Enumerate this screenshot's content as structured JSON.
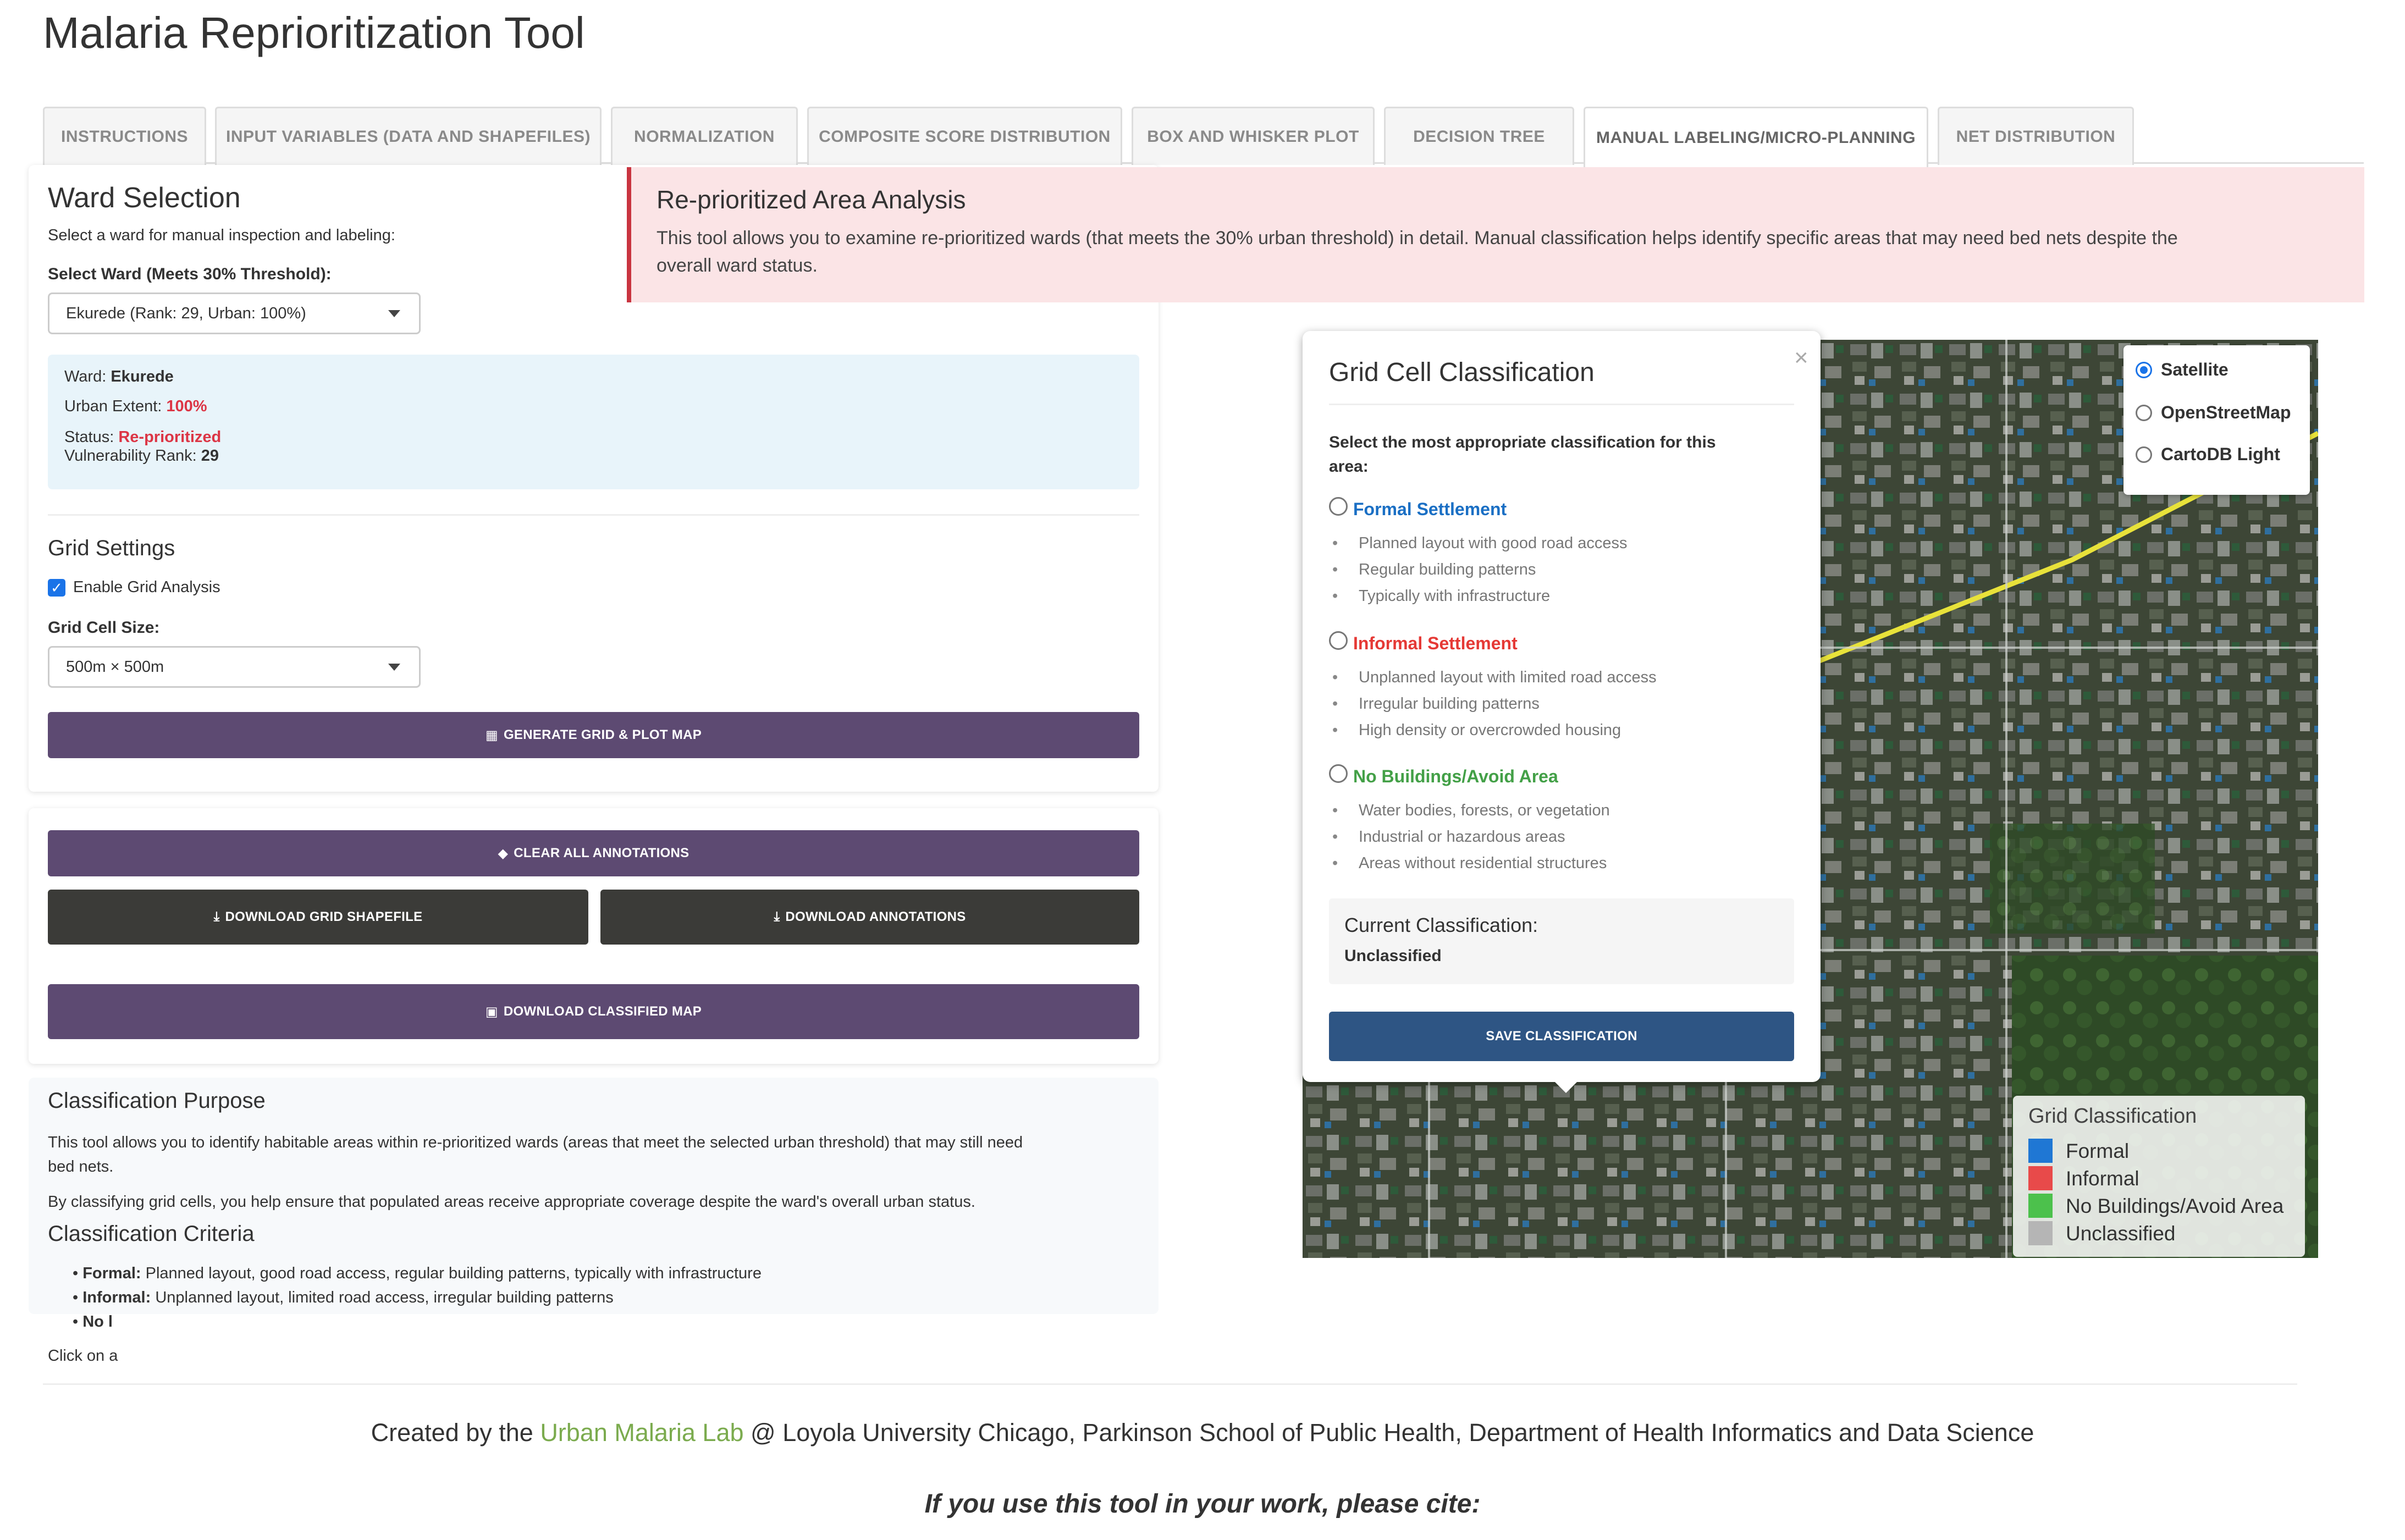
{
  "app": {
    "title": "Malaria Reprioritization Tool"
  },
  "tabs": [
    {
      "label": "INSTRUCTIONS"
    },
    {
      "label": "INPUT VARIABLES (DATA AND SHAPEFILES)"
    },
    {
      "label": "NORMALIZATION"
    },
    {
      "label": "COMPOSITE SCORE DISTRIBUTION"
    },
    {
      "label": "BOX AND WHISKER PLOT"
    },
    {
      "label": "DECISION TREE"
    },
    {
      "label": "MANUAL LABELING/MICRO-PLANNING"
    },
    {
      "label": "NET DISTRIBUTION"
    }
  ],
  "active_tab": "MANUAL LABELING/MICRO-PLANNING",
  "ward_selection": {
    "title": "Ward Selection",
    "description": "Select a ward for manual inspection and labeling:",
    "select_label": "Select Ward (Meets 30% Threshold):",
    "selected_value": "Ekurede (Rank: 29, Urban: 100%)",
    "info": {
      "ward_label": "Ward:",
      "ward_value": "Ekurede",
      "urban_label": "Urban Extent:",
      "urban_value": "100%",
      "status_label": "Status:",
      "status_value": "Re-prioritized",
      "rank_label": "Vulnerability Rank:",
      "rank_value": "29"
    }
  },
  "grid_settings": {
    "title": "Grid Settings",
    "checkbox_label": "Enable Grid Analysis",
    "checked": true,
    "cell_size_label": "Grid Cell Size:",
    "cell_size_value": "500m × 500m",
    "generate_button": "GENERATE GRID & PLOT MAP"
  },
  "actions": {
    "clear_button": "CLEAR ALL ANNOTATIONS",
    "download_grid_button": "DOWNLOAD GRID SHAPEFILE",
    "download_annotations_button": "DOWNLOAD ANNOTATIONS",
    "download_map_button": "DOWNLOAD CLASSIFIED MAP"
  },
  "purpose": {
    "title": "Classification Purpose",
    "text1a": "This tool allows you to identify habitable areas within re-prioritized wards (areas that meet the selected urban threshold) that may still need",
    "text1b": "bed nets.",
    "text2": "By classifying grid cells, you help ensure that populated areas receive appropriate coverage despite the ward's overall urban status.",
    "criteria_title": "Classification Criteria",
    "criteria": [
      {
        "label": "Formal:",
        "text": "Planned layout, good road access, regular building patterns, typically with infrastructure"
      },
      {
        "label": "Informal:",
        "text": "Unplanned layout, limited road access, irregular building patterns"
      },
      {
        "label": "No l",
        "text": ""
      }
    ],
    "click_text": "Click on a"
  },
  "alert": {
    "title": "Re-prioritized Area Analysis",
    "text_line1": "This tool allows you to examine re-prioritized wards (that meets the 30% urban threshold) in detail. Manual classification helps identify specific areas that may need bed nets despite the",
    "text_line2": "overall ward status."
  },
  "popup": {
    "title": "Grid Cell Classification",
    "close": "×",
    "prompt_line1": "Select the most appropriate classification for this",
    "prompt_line2": "area:",
    "options": [
      {
        "label": "Formal Settlement",
        "color": "#1a6fc4",
        "bullets": [
          "Planned layout with good road access",
          "Regular building patterns",
          "Typically with infrastructure"
        ]
      },
      {
        "label": "Informal Settlement",
        "color": "#e53935",
        "bullets": [
          "Unplanned layout with limited road access",
          "Irregular building patterns",
          "High density or overcrowded housing"
        ]
      },
      {
        "label": "No Buildings/Avoid Area",
        "color": "#43a047",
        "bullets": [
          "Water bodies, forests, or vegetation",
          "Industrial or hazardous areas",
          "Areas without residential structures"
        ]
      }
    ],
    "current_label": "Current Classification:",
    "current_value": "Unclassified",
    "save_button": "SAVE CLASSIFICATION"
  },
  "layers": {
    "options": [
      "Satellite",
      "OpenStreetMap",
      "CartoDB Light"
    ],
    "selected": "Satellite"
  },
  "legend": {
    "title": "Grid Classification",
    "items": [
      {
        "label": "Formal",
        "color": "#1f77d4"
      },
      {
        "label": "Informal",
        "color": "#e84a4a"
      },
      {
        "label": "No Buildings/Avoid Area",
        "color": "#4cc14c"
      },
      {
        "label": "Unclassified",
        "color": "#b5b5b5"
      }
    ]
  },
  "footer": {
    "prefix": "Created by the ",
    "lab": "Urban Malaria Lab",
    "suffix": " @ Loyola University Chicago, Parkinson School of Public Health, Department of Health Informatics and Data Science",
    "cite": "If you use this tool in your work, please cite:"
  }
}
